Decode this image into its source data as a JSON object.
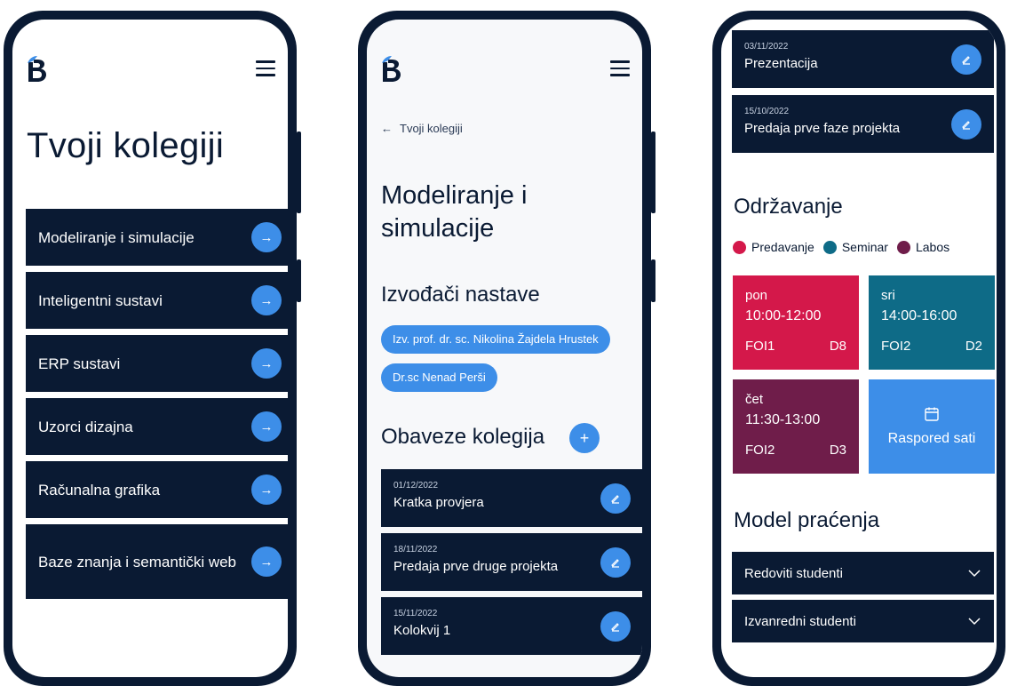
{
  "colors": {
    "navy": "#0a1a33",
    "accent_blue": "#3d8ee8",
    "predavanje": "#d4184a",
    "seminar": "#0e6b87",
    "labos": "#6f1d4a"
  },
  "courses_screen": {
    "title": "Tvoji kolegiji",
    "courses": [
      {
        "label": "Modeliranje i simulacije"
      },
      {
        "label": "Inteligentni sustavi"
      },
      {
        "label": "ERP sustavi"
      },
      {
        "label": "Uzorci dizajna"
      },
      {
        "label": "Računalna grafika"
      },
      {
        "label": "Baze znanja i semantički web"
      }
    ],
    "arrow_icon": "arrow-right-icon"
  },
  "course_screen": {
    "back_label": "Tvoji kolegiji",
    "title_line1": "Modeliranje i",
    "title_line2": "simulacije",
    "lecturers_heading": "Izvođači nastave",
    "lecturers": [
      "Izv. prof. dr. sc. Nikolina Žajdela Hrustek",
      "Dr.sc Nenad Perši"
    ],
    "obligations_heading": "Obaveze kolegija",
    "obligations": [
      {
        "date": "01/12/2022",
        "title": "Kratka provjera"
      },
      {
        "date": "18/11/2022",
        "title": "Predaja prve druge projekta"
      },
      {
        "date": "15/11/2022",
        "title": "Kolokvij 1"
      }
    ]
  },
  "details_screen": {
    "obligations": [
      {
        "date": "03/11/2022",
        "title": "Prezentacija"
      },
      {
        "date": "15/10/2022",
        "title": "Predaja prve faze projekta"
      }
    ],
    "schedule_heading": "Održavanje",
    "legend": [
      {
        "label": "Predavanje",
        "color": "#d4184a"
      },
      {
        "label": "Seminar",
        "color": "#0e6b87"
      },
      {
        "label": "Labos",
        "color": "#6f1d4a"
      }
    ],
    "slots": [
      {
        "day": "pon",
        "time": "10:00-12:00",
        "building": "FOI1",
        "room": "D8",
        "type": "Predavanje"
      },
      {
        "day": "sri",
        "time": "14:00-16:00",
        "building": "FOI2",
        "room": "D2",
        "type": "Seminar"
      },
      {
        "day": "čet",
        "time": "11:30-13:00",
        "building": "FOI2",
        "room": "D3",
        "type": "Labos"
      }
    ],
    "schedule_button": "Raspored sati",
    "tracking_heading": "Model praćenja",
    "tracking": [
      {
        "label": "Redoviti studenti"
      },
      {
        "label": "Izvanredni studenti"
      }
    ]
  }
}
